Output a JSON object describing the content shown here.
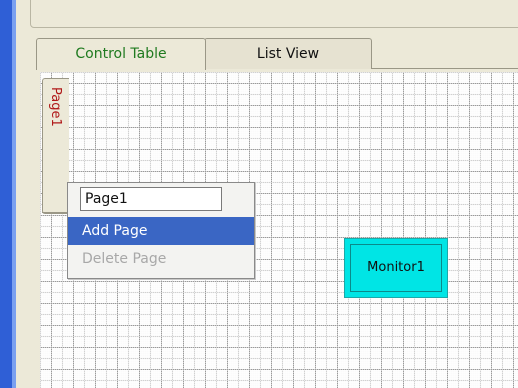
{
  "tabs": [
    {
      "label": "Control Table",
      "active": true
    },
    {
      "label": "List View",
      "active": false
    }
  ],
  "page_tabs": [
    {
      "label": "Page1"
    }
  ],
  "context_menu": {
    "page_name_value": "Page1",
    "items": [
      {
        "label": "Add Page",
        "highlighted": true,
        "enabled": true
      },
      {
        "label": "Delete Page",
        "highlighted": false,
        "enabled": false
      }
    ]
  },
  "canvas": {
    "controls": [
      {
        "label": "Monitor1",
        "color": "#00e5e5"
      }
    ]
  },
  "colors": {
    "active_tab_text": "#1f7a1f",
    "page_tab_text": "#b01818",
    "menu_highlight": "#3a66c4"
  }
}
